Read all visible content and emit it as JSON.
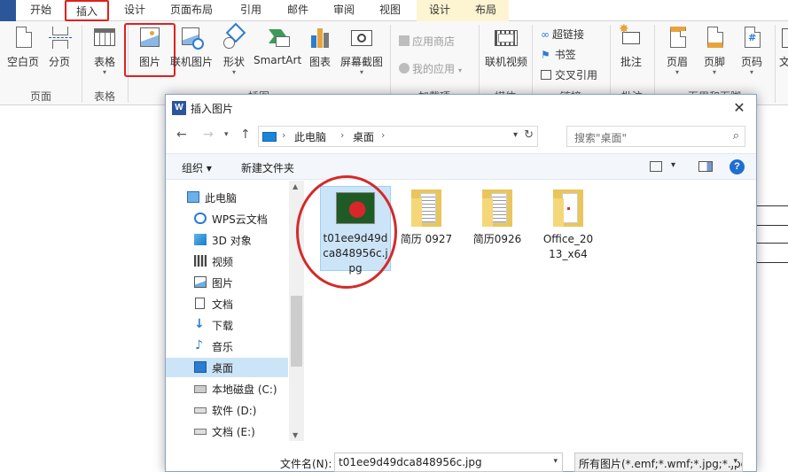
{
  "ribbon_tabs": [
    "开始",
    "插入",
    "设计",
    "页面布局",
    "引用",
    "邮件",
    "审阅",
    "视图",
    "设计",
    "布局"
  ],
  "ribbon": {
    "buttons": {
      "blank_page": "空白页",
      "page_break": "分页",
      "table": "表格",
      "picture": "图片",
      "online_picture": "联机图片",
      "shapes": "形状",
      "smartart": "SmartArt",
      "chart": "图表",
      "screenshot": "屏幕截图",
      "app_store": "应用商店",
      "my_apps": "我的应用",
      "online_video": "联机视频",
      "hyperlink": "超链接",
      "bookmark": "书签",
      "cross_ref": "交叉引用",
      "comment": "批注",
      "header": "页眉",
      "footer": "页脚",
      "page_number": "页码",
      "text": "文"
    },
    "groups": {
      "pages": "页面",
      "tables": "表格",
      "illustrations": "插图",
      "addins": "加载项",
      "media": "媒体",
      "links": "链接",
      "comments": "批注",
      "header_footer": "页眉和页脚"
    }
  },
  "dialog": {
    "title": "插入图片",
    "address": [
      "此电脑",
      "桌面"
    ],
    "search_placeholder": "搜索\"桌面\"",
    "organize": "组织 ▾",
    "new_folder": "新建文件夹",
    "nav_items": [
      "此电脑",
      "WPS云文档",
      "3D 对象",
      "视频",
      "图片",
      "文档",
      "下载",
      "音乐",
      "桌面",
      "本地磁盘 (C:)",
      "软件 (D:)",
      "文档 (E:)"
    ],
    "files": [
      "t01ee9d49dca848956c.jpg",
      "简历 0927",
      "简历0926",
      "Office_2013_x64"
    ],
    "filename_label": "文件名(N):",
    "filename_value": "t01ee9d49dca848956c.jpg",
    "filter": "所有图片(*.emf;*.wmf;*.jpg;*.jpeg"
  },
  "colors": {
    "accent": "#2b579a",
    "highlight_red": "#e02020",
    "selection": "#cce4f7"
  }
}
